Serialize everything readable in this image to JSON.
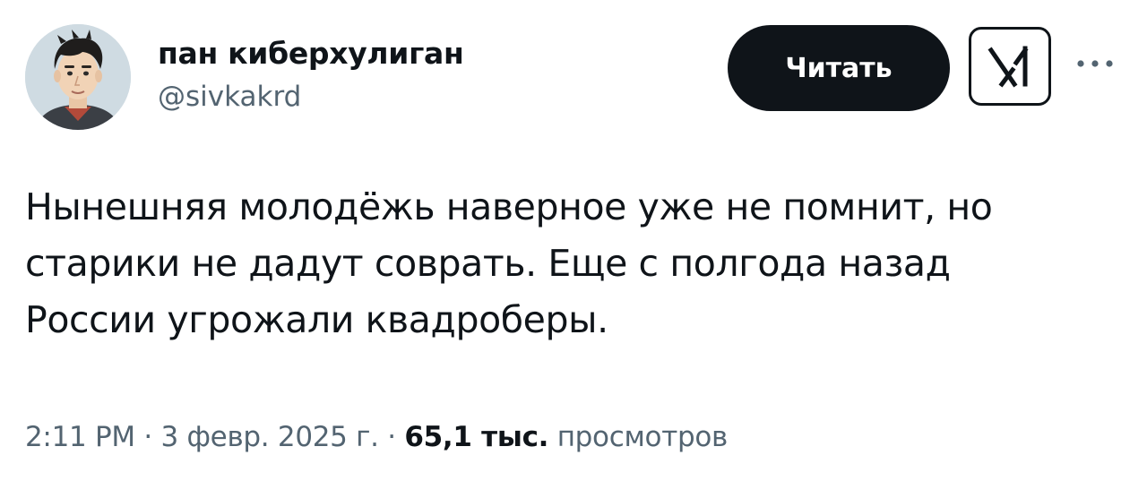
{
  "author": {
    "display_name": "пан киберхулиган",
    "handle": "@sivkakrd",
    "avatar_icon": "avatar-portrait"
  },
  "actions": {
    "follow_label": "Читать",
    "grok_icon": "grok-icon",
    "more_icon": "more-icon"
  },
  "tweet": {
    "lines": [
      "Нынешняя молодёжь наверное уже не помнит, но",
      "старики не дадут соврать. Еще с полгода назад",
      "России угрожали квадроберы."
    ]
  },
  "meta": {
    "time": "2:11 PM",
    "separator": "·",
    "date": "3 февр. 2025 г.",
    "views_count": "65,1 тыс.",
    "views_label": "просмотров"
  },
  "colors": {
    "text_primary": "#0f1419",
    "text_secondary": "#536471",
    "button_bg": "#0f1419",
    "button_text": "#ffffff"
  }
}
